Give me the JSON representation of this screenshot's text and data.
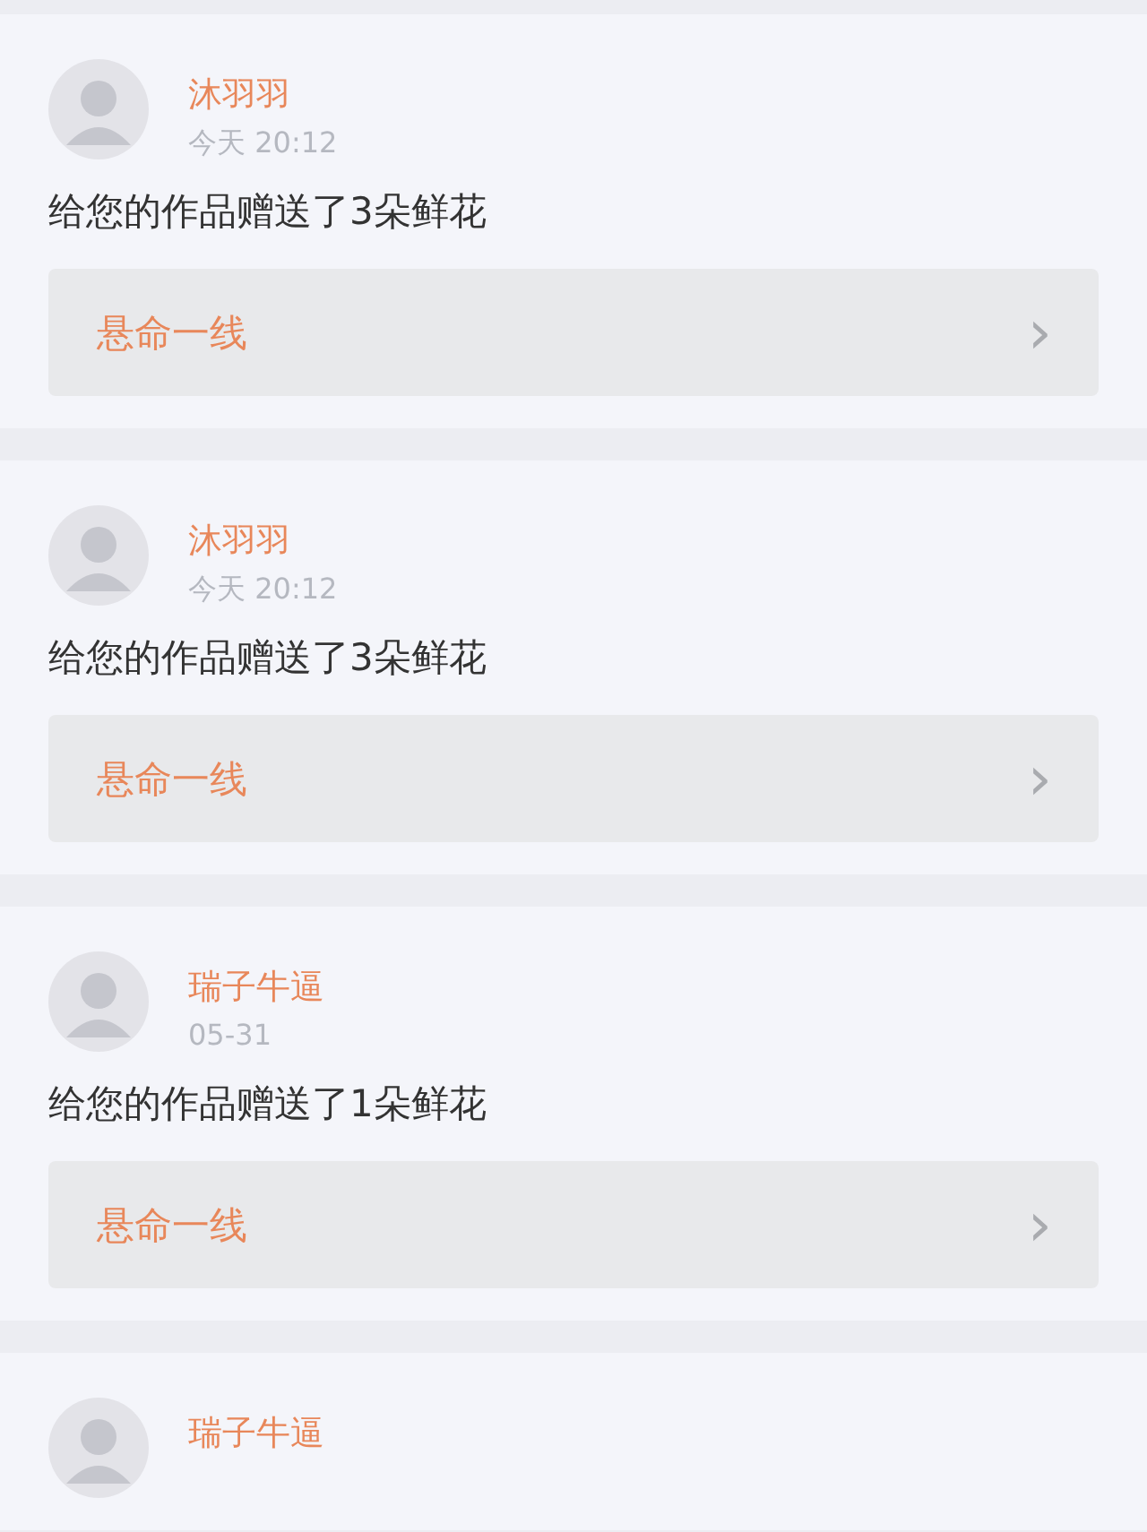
{
  "notifications": [
    {
      "name": "沐羽羽",
      "time": "今天 20:12",
      "message": "给您的作品赠送了3朵鲜花",
      "work": {
        "title": "悬命一线",
        "arrow": "›"
      }
    },
    {
      "name": "沐羽羽",
      "time": "今天 20:12",
      "message": "给您的作品赠送了3朵鲜花",
      "work": {
        "title": "悬命一线",
        "arrow": "›"
      }
    },
    {
      "name": "瑞子牛逼",
      "time": "05-31",
      "message": "给您的作品赠送了1朵鲜花",
      "work": {
        "title": "悬命一线",
        "arrow": "›"
      }
    },
    {
      "name": "瑞子牛逼"
    }
  ]
}
